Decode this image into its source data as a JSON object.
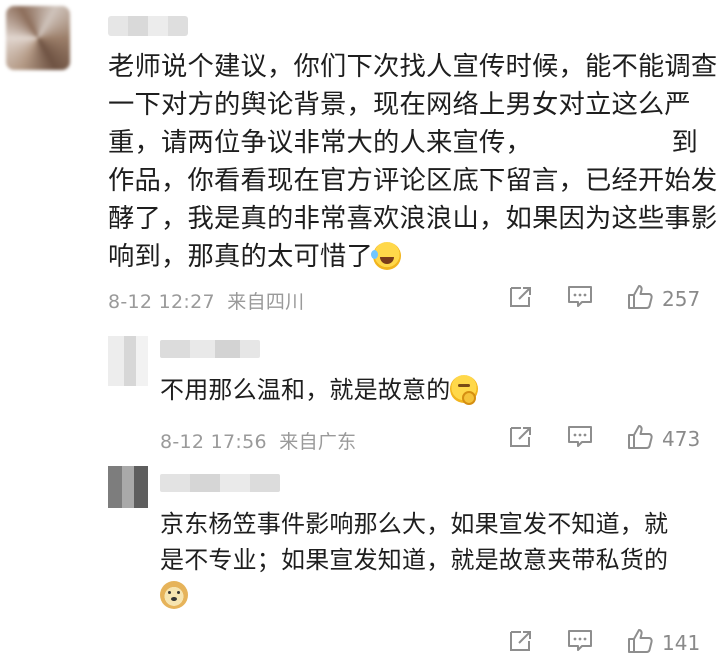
{
  "main_comment": {
    "lines": [
      "老师说个建议，你们下次找人宣传时候，能不能调查",
      "一下对方的舆论背景，现在网络上男女对立这么严",
      "重，请两位争议非常大的人来宣传，",
      "到",
      "作品，你看看现在官方评论区底下留言，已经开始发",
      "酵了，我是真的非常喜欢浪浪山，如果因为这些事影",
      "响到，那真的太可惜了"
    ],
    "emoji": "laughing-crying-emoji",
    "timestamp": "8-12 12:27",
    "location": "来自四川",
    "likes": "257"
  },
  "replies": [
    {
      "text_lines": [
        "不用那么温和，就是故意的"
      ],
      "emoji": "thinking-emoji",
      "timestamp": "8-12 17:56",
      "location": "来自广东",
      "likes": "473"
    },
    {
      "text_lines": [
        "京东杨笠事件影响那么大，如果宣发不知道，就",
        "是不专业；如果宣发知道，就是故意夹带私货的"
      ],
      "emoji": "doge-emoji",
      "likes": "141"
    }
  ],
  "icons": {
    "share": "share-icon",
    "comment": "comment-icon",
    "like": "thumbs-up-icon"
  },
  "colors": {
    "text": "#1e1e1e",
    "meta": "#9a9a9a",
    "background": "#ffffff",
    "reply_background": "#ffffff"
  }
}
